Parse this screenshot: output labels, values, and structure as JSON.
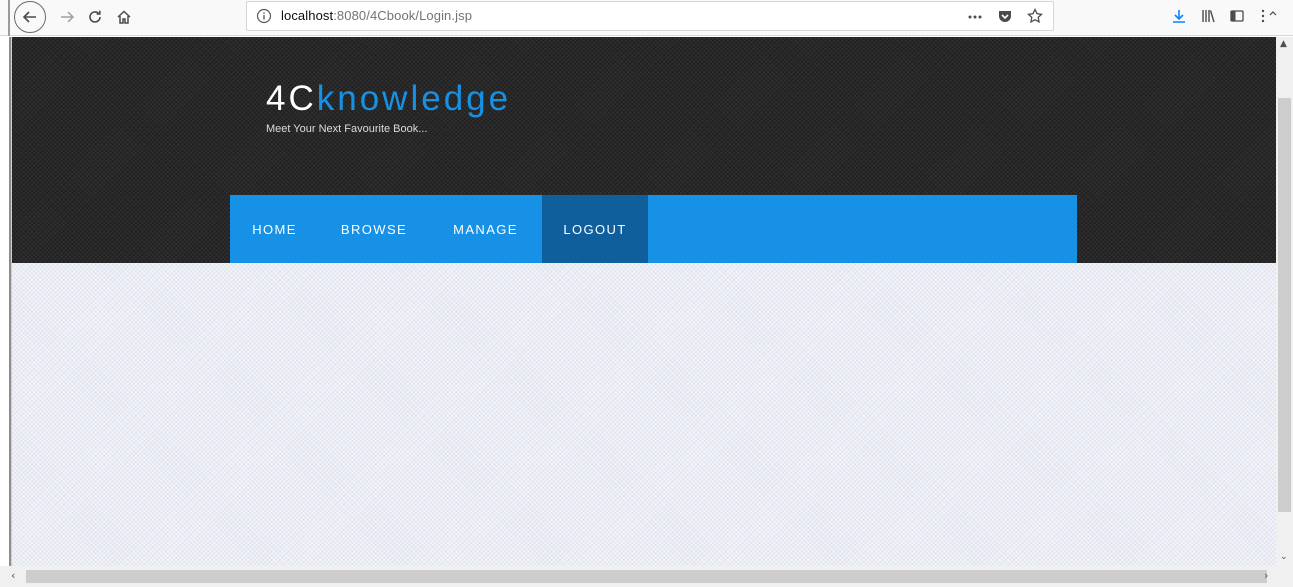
{
  "browser": {
    "url_host": "localhost",
    "url_rest": ":8080/4Cbook/Login.jsp",
    "icons": {
      "back": "back-arrow-icon",
      "forward": "forward-arrow-icon",
      "reload": "reload-icon",
      "home": "home-icon",
      "info": "info-icon",
      "more": "more-actions-icon",
      "pocket": "pocket-icon",
      "bookmark": "bookmark-star-icon",
      "download": "download-icon",
      "library": "library-icon",
      "sidebar": "sidebar-icon",
      "overflow": "overflow-menu-icon"
    },
    "colors": {
      "toolbar_bg": "#f9f9fa",
      "download_accent": "#0a84ff"
    }
  },
  "site": {
    "logo_part1": "4C",
    "logo_part2": "knowledge",
    "tagline": "Meet Your Next Favourite Book...",
    "colors": {
      "accent": "#1691e6",
      "nav_active": "#0f5f9c",
      "header_bg": "#262626",
      "content_bg": "#eceef6"
    },
    "nav": [
      {
        "label": "HOME",
        "active": false
      },
      {
        "label": "BROWSE",
        "active": false
      },
      {
        "label": "MANAGE",
        "active": false
      },
      {
        "label": "LOGOUT",
        "active": true
      }
    ]
  }
}
